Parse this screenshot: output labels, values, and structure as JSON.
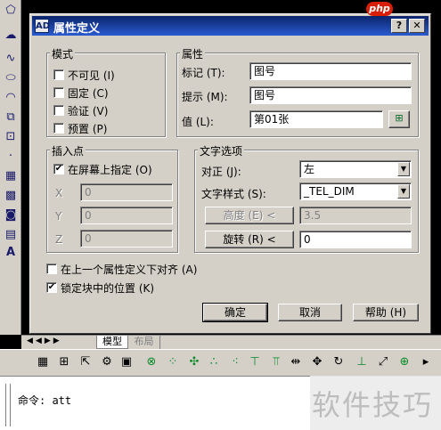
{
  "dialog": {
    "title": "属性定义",
    "title_icon_label": "AD",
    "close_glyph": "✕",
    "help_glyph": "?"
  },
  "mode": {
    "legend": "模式",
    "invisible": "不可见 (I)",
    "constant": "固定 (C)",
    "verify": "验证 (V)",
    "preset": "预置 (P)"
  },
  "attribute": {
    "legend": "属性",
    "tag_label": "标记 (T):",
    "tag_value": "图号",
    "prompt_label": "提示 (M):",
    "prompt_value": "图号",
    "value_label": "值 (L):",
    "value_value": "第01张"
  },
  "insertion": {
    "legend": "插入点",
    "onscreen_label": "在屏幕上指定 (O)",
    "onscreen_checked": true,
    "x_label": "X",
    "x_value": "0",
    "y_label": "Y",
    "y_value": "0",
    "z_label": "Z",
    "z_value": "0"
  },
  "text_options": {
    "legend": "文字选项",
    "justify_label": "对正 (J):",
    "justify_value": "左",
    "style_label": "文字样式 (S):",
    "style_value": "_TEL_DIM",
    "height_button": "高度 (E) <",
    "height_value": "3.5",
    "rotation_button": "旋转 (R) <",
    "rotation_value": "0"
  },
  "align_below_label": "在上一个属性定义下对齐 (A)",
  "lock_position_label": "锁定块中的位置 (K)",
  "lock_position_checked": true,
  "buttons": {
    "ok": "确定",
    "cancel": "取消",
    "help": "帮助 (H)"
  },
  "tabs": {
    "model": "模型",
    "layout": "布局"
  },
  "command": {
    "line": "命令: att"
  },
  "watermark": {
    "brand": "php",
    "text": "软件技巧"
  }
}
